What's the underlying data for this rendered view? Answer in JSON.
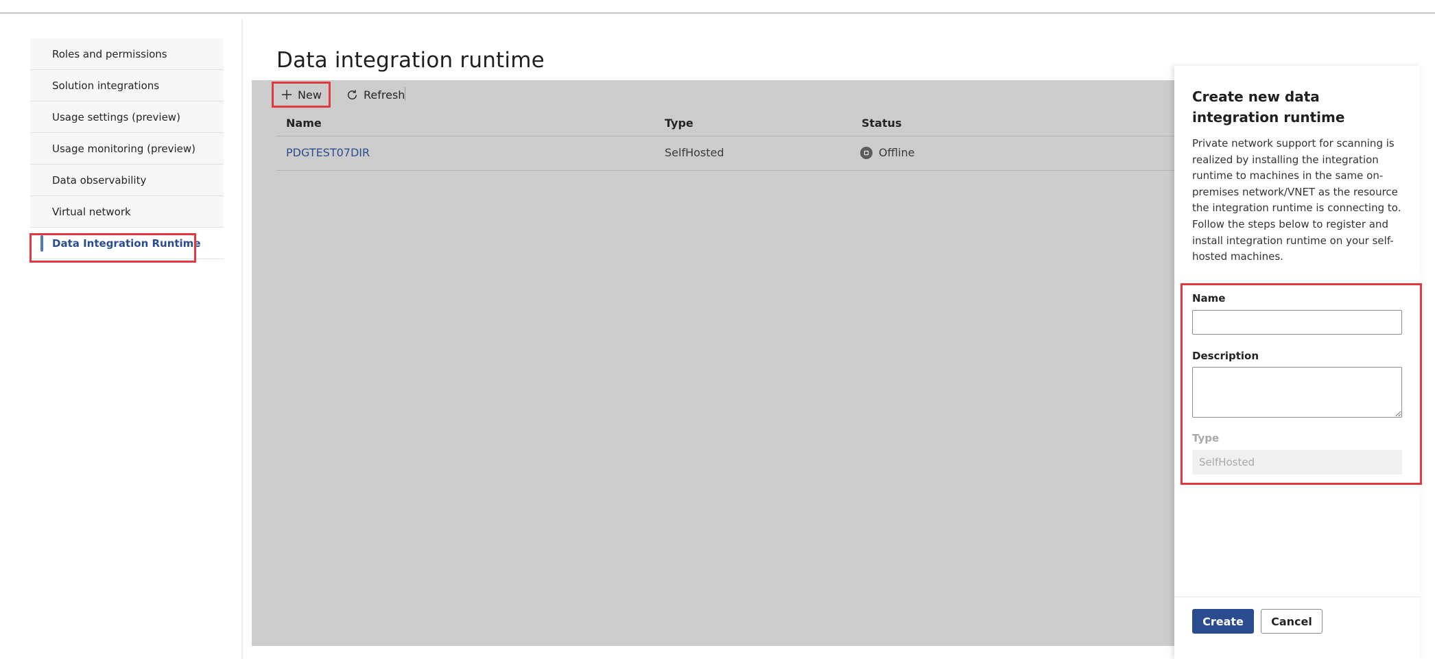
{
  "sidebar": {
    "items": [
      {
        "label": "Roles and permissions"
      },
      {
        "label": "Solution integrations"
      },
      {
        "label": "Usage settings (preview)"
      },
      {
        "label": "Usage monitoring (preview)"
      },
      {
        "label": "Data observability"
      },
      {
        "label": "Virtual network"
      },
      {
        "label": "Data Integration Runtime",
        "active": true
      }
    ]
  },
  "page": {
    "title": "Data integration runtime"
  },
  "toolbar": {
    "new_label": "New",
    "new_icon": "plus-icon",
    "refresh_label": "Refresh",
    "refresh_icon": "refresh-icon"
  },
  "table": {
    "columns": [
      "Name",
      "Type",
      "Status"
    ],
    "rows": [
      {
        "name": "PDGTEST07DIR",
        "type": "SelfHosted",
        "status": "Offline",
        "status_icon": "stop-circle-icon"
      }
    ]
  },
  "panel": {
    "title": "Create new data integration runtime",
    "description": "Private network support for scanning is realized by installing the integration runtime to machines in the same on-premises network/VNET as the resource the integration runtime is connecting to. Follow the steps below to register and install integration runtime on your self-hosted machines.",
    "name_label": "Name",
    "name_value": "",
    "description_label": "Description",
    "description_value": "",
    "type_label": "Type",
    "type_value": "SelfHosted",
    "create_label": "Create",
    "cancel_label": "Cancel"
  },
  "colors": {
    "accent": "#2b4d8f",
    "active_bar": "#4a7cc5",
    "highlight": "#e0393e",
    "overlay": "#cccccc"
  }
}
